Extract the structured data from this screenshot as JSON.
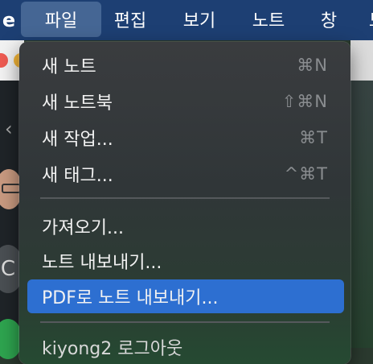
{
  "menubar": {
    "app_fragment": "e",
    "items": [
      {
        "label": "파일",
        "active": true
      },
      {
        "label": "편집"
      },
      {
        "label": "보기"
      },
      {
        "label": "노트"
      },
      {
        "label": "창"
      },
      {
        "label": "도"
      }
    ]
  },
  "file_menu": {
    "items": [
      {
        "label": "새 노트",
        "shortcut": "⌘N"
      },
      {
        "label": "새 노트북",
        "shortcut": "⇧⌘N"
      },
      {
        "label": "새 작업...",
        "shortcut": "⌘T"
      },
      {
        "label": "새 태그...",
        "shortcut": "^⌘T"
      },
      {
        "label": "가져오기..."
      },
      {
        "label": "노트 내보내기..."
      },
      {
        "label": "PDF로 노트 내보내기...",
        "highlighted": true
      },
      {
        "label": "kiyong2 로그아웃"
      }
    ]
  },
  "background_app": {
    "avatar_letter": "C",
    "back_chevron": "‹"
  },
  "colors": {
    "menubar": "#1d3f73",
    "menu_active": "#456694",
    "highlight": "#2d6fd1"
  }
}
